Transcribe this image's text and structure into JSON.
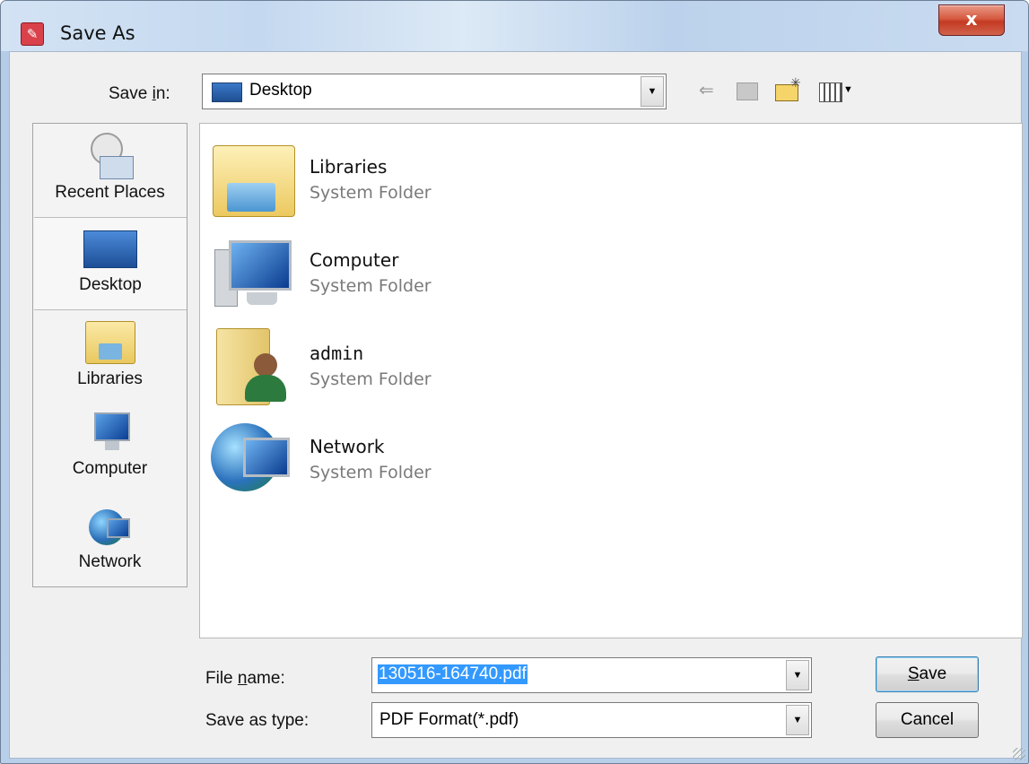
{
  "window": {
    "title": "Save As",
    "close_label": "x"
  },
  "save_in": {
    "label_prefix": "Save ",
    "label_access": "i",
    "label_suffix": "n:",
    "location": "Desktop"
  },
  "places": [
    {
      "label": "Recent Places",
      "icon": "recent-places-icon"
    },
    {
      "label": "Desktop",
      "icon": "desktop-icon",
      "selected": true
    },
    {
      "label": "Libraries",
      "icon": "libraries-icon"
    },
    {
      "label": "Computer",
      "icon": "computer-icon"
    },
    {
      "label": "Network",
      "icon": "network-icon"
    }
  ],
  "files": [
    {
      "name": "Libraries",
      "type": "System Folder",
      "icon": "libraries-folder-icon"
    },
    {
      "name": "Computer",
      "type": "System Folder",
      "icon": "computer-icon"
    },
    {
      "name": "admin",
      "type": "System Folder",
      "icon": "user-folder-icon"
    },
    {
      "name": "Network",
      "type": "System Folder",
      "icon": "network-icon"
    }
  ],
  "file_name": {
    "label_prefix": "File ",
    "label_access": "n",
    "label_suffix": "ame:",
    "value": "130516-164740.pdf"
  },
  "save_type": {
    "label": "Save as type:",
    "value": "PDF Format(*.pdf)"
  },
  "buttons": {
    "save_access": "S",
    "save_rest": "ave",
    "cancel": "Cancel"
  }
}
